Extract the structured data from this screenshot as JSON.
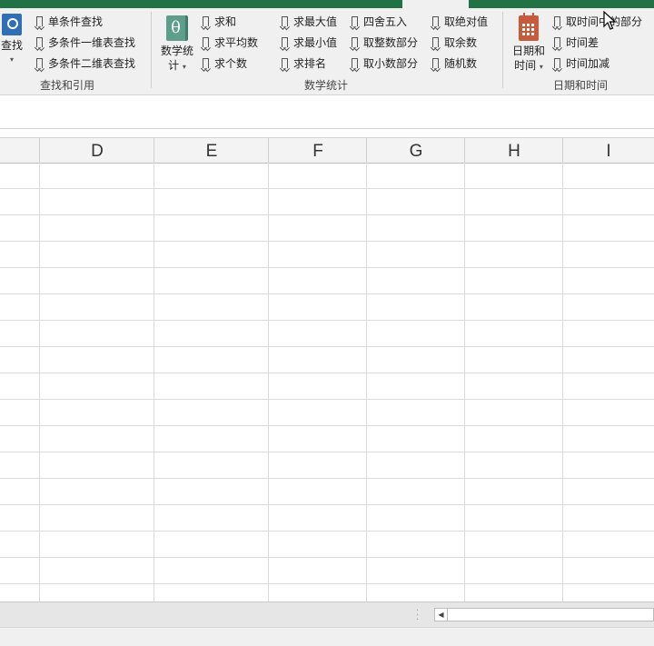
{
  "ribbon": {
    "lookup_group": {
      "big_button_label": "查找",
      "items": [
        "单条件查找",
        "多条件一维表查找",
        "多条件二维表查找"
      ],
      "group_label": "查找和引用"
    },
    "math_group": {
      "big_button_label_line1": "数学统",
      "big_button_label_line2": "计",
      "big_icon_glyph": "θ",
      "col1": [
        "求和",
        "求平均数",
        "求个数"
      ],
      "col2": [
        "求最大值",
        "求最小值",
        "求排名"
      ],
      "col3": [
        "四舍五入",
        "取整数部分",
        "取小数部分"
      ],
      "col4": [
        "取绝对值",
        "取余数",
        "随机数"
      ],
      "group_label": "数学统计"
    },
    "date_group": {
      "big_button_label_line1": "日期和",
      "big_button_label_line2": "时间",
      "items": [
        "取时间中的部分",
        "时间差",
        "时间加减"
      ],
      "group_label": "日期和时间"
    }
  },
  "sheet": {
    "columns": [
      "D",
      "E",
      "F",
      "G",
      "H",
      "I"
    ]
  },
  "colors": {
    "title_bar": "#217346",
    "ribbon_bg": "#f0f0f0",
    "gridline": "#dadada"
  }
}
